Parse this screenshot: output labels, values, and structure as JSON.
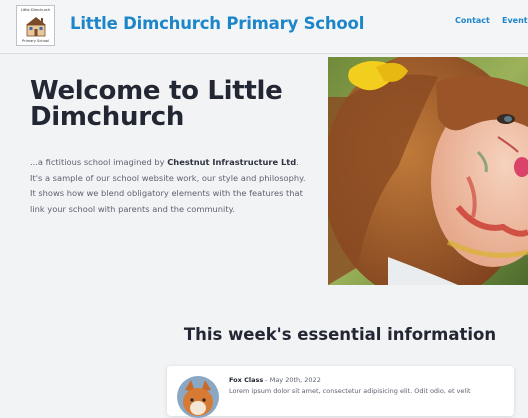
{
  "header": {
    "logo": {
      "top_text": "Little Dimchurch",
      "bottom_text": "Primary School",
      "icon": "school-house-icon"
    },
    "title": "Little Dimchurch Primary School",
    "nav": [
      {
        "label": "Contact"
      },
      {
        "label": "Events"
      }
    ]
  },
  "hero": {
    "title": "Welcome to Little Dimchurch",
    "intro_before": "...a fictitious school imagined by ",
    "intro_company": "Chestnut Infrastructure Ltd",
    "intro_after": ". It's a sample of our school website work, our style and philosophy. It shows how we blend obligatory elements with the features that link your school with parents and the community.",
    "photo": "child-with-paint-photo"
  },
  "info": {
    "heading": "This week's essential information",
    "posts": [
      {
        "class_name": "Fox Class",
        "date": " - May 20th, 2022",
        "text": "Lorem ipsum dolor sit amet, consectetur adipisicing elit. Odit odio, et velit",
        "avatar": "fox-avatar-icon"
      }
    ]
  },
  "colors": {
    "brand_blue": "#1d86c9",
    "heading_dark": "#222733",
    "page_bg": "#f2f3f5"
  }
}
